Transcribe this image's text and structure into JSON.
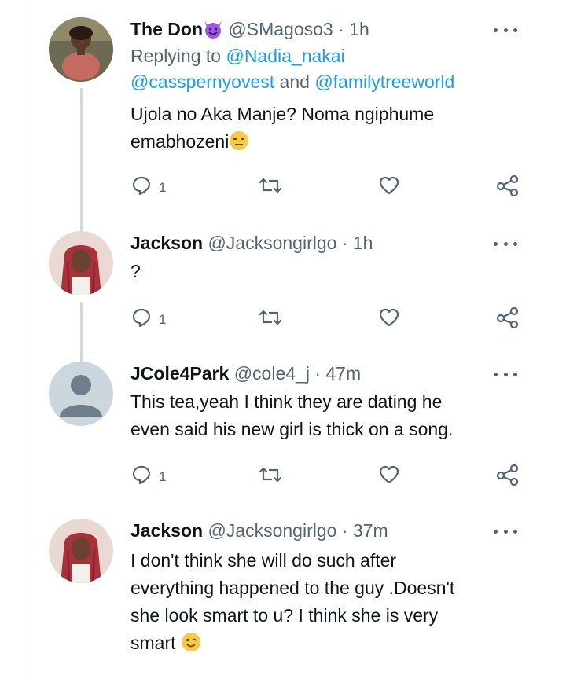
{
  "tweets": [
    {
      "name": "The Don",
      "handle": "@SMagoso3",
      "separator": "·",
      "time": "1h",
      "emoji": "smiling-devil-emoji",
      "replying_prefix": "Replying to",
      "replying_to_1": "@Nadia_nakai",
      "replying_to_2": "@casspernyovest",
      "replying_and": "and",
      "replying_to_3": "@familytreeworld",
      "text_line1": "Ujola no Aka Manje? Noma ngiphume",
      "text_line2": "emabhozeni",
      "text_emoji": "expressionless-face-emoji",
      "reply_count": "1"
    },
    {
      "name": "Jackson",
      "handle": "@Jacksongirlgo",
      "separator": "·",
      "time": "1h",
      "text_line1": "?",
      "reply_count": "1"
    },
    {
      "name": "JCole4Park",
      "handle": "@cole4_j",
      "separator": "·",
      "time": "47m",
      "text_line1": "This tea,yeah I think they are dating he",
      "text_line2": "even said his new girl is thick on a song.",
      "reply_count": "1"
    },
    {
      "name": "Jackson",
      "handle": "@Jacksongirlgo",
      "separator": "·",
      "time": "37m",
      "text_line1": "I don't think she will do such after",
      "text_line2": "everything happened to the guy .Doesn't",
      "text_line3": "she look smart to u? I think she is very",
      "text_line4": "smart",
      "text_emoji": "winking-face-emoji"
    }
  ],
  "icons": {
    "reply": "reply-icon",
    "retweet": "retweet-icon",
    "like": "heart-icon",
    "share": "share-icon",
    "more": "more-icon"
  },
  "colors": {
    "text": "#0f1419",
    "secondary": "#536471",
    "mention": "#1d9bf0",
    "thread_line": "#cfd9de"
  }
}
